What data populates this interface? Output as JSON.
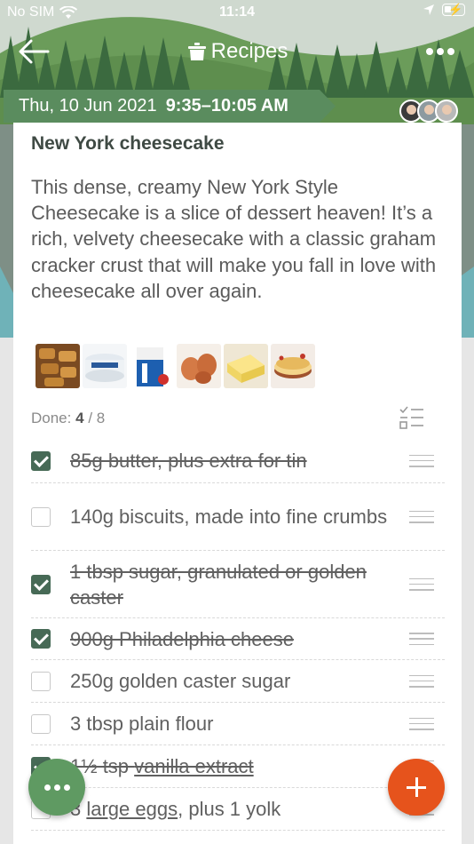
{
  "status_bar": {
    "carrier": "No SIM",
    "time": "11:14"
  },
  "nav": {
    "title": "Recipes",
    "back_icon": "arrow-left-icon",
    "more_icon": "ellipsis-icon",
    "title_icon": "pot-icon"
  },
  "event": {
    "date": "Thu, 10 Jun 2021",
    "time_range": "9:35–10:05 AM"
  },
  "recipe": {
    "title": "New York cheesecake",
    "description": "This dense, creamy New York Style Cheesecake is a slice of dessert heaven! It’s a rich, velvety cheesecake with a classic graham cracker crust that will make you fall in love with cheesecake all over again."
  },
  "thumbnails": [
    "biscuits",
    "cream-cheese-tub",
    "milk-carton",
    "eggs",
    "butter",
    "cheesecake"
  ],
  "progress": {
    "label": "Done:",
    "done": "4",
    "sep": "/",
    "total": "8"
  },
  "items": [
    {
      "text": "85g butter, plus extra for tin",
      "checked": true
    },
    {
      "text": "140g biscuits, made into fine crumbs",
      "checked": false
    },
    {
      "text": "1 tbsp sugar, granulated or golden caster",
      "checked": true
    },
    {
      "text": "900g Philadelphia cheese",
      "checked": true
    },
    {
      "text": "250g golden caster sugar",
      "checked": false
    },
    {
      "text": "3 tbsp plain flour",
      "checked": false
    },
    {
      "text_a": "1½ tsp ",
      "link": "vanilla extract",
      "checked": true
    },
    {
      "text_a": "3 ",
      "link": "large eggs",
      "text_b": ", plus 1 yolk",
      "checked": false
    }
  ],
  "colors": {
    "accent_green": "#5a8c5e",
    "check_green": "#476a56",
    "fab_orange": "#e6531c"
  }
}
